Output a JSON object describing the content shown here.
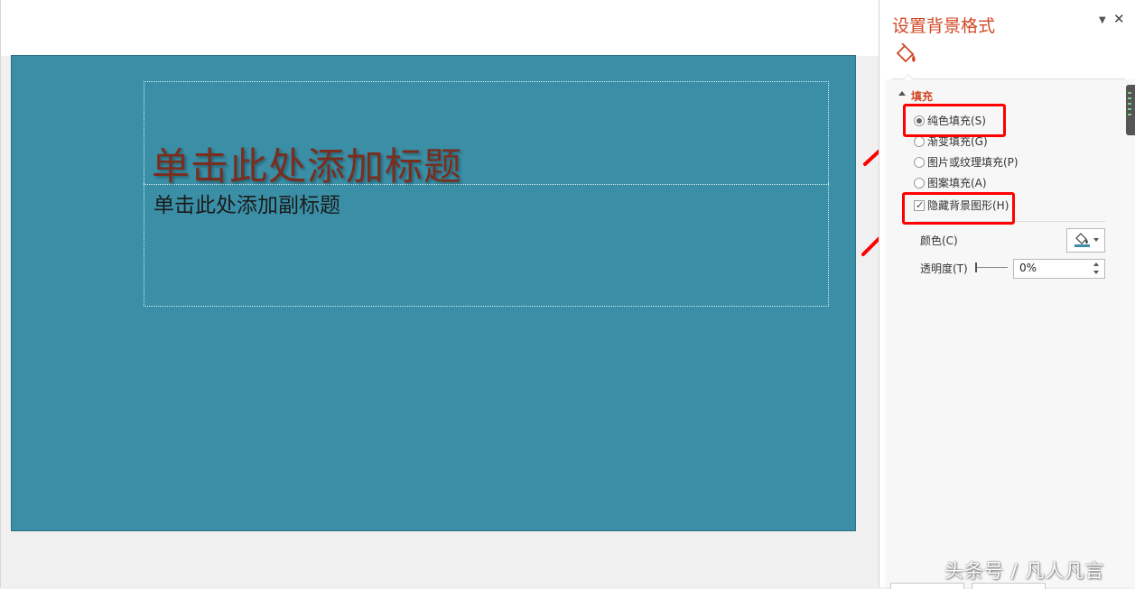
{
  "slide": {
    "background_color": "#3a8fa7",
    "title_placeholder": "单击此处添加标题",
    "subtitle_placeholder": "单击此处添加副标题"
  },
  "pane": {
    "title": "设置背景格式",
    "dropdown_icon": "triangle-down-icon",
    "close_label": "✕",
    "tab_icon": "paint-bucket-icon",
    "section_fill": "填充",
    "options": {
      "solid_fill": "纯色填充(S)",
      "gradient_fill": "渐变填充(G)",
      "picture_fill": "图片或纹理填充(P)",
      "pattern_fill": "图案填充(A)",
      "hide_background_graphics": "隐藏背景图形(H)"
    },
    "selected_fill": "solid_fill",
    "hide_background_graphics_checked": true,
    "color_label": "颜色(C)",
    "transparency_label": "透明度(T)",
    "transparency_value": "0%",
    "transparency": 0
  },
  "watermark": "头条号 / 凡人凡言",
  "accent_color": "#d24726",
  "highlight_color": "#ff0000"
}
